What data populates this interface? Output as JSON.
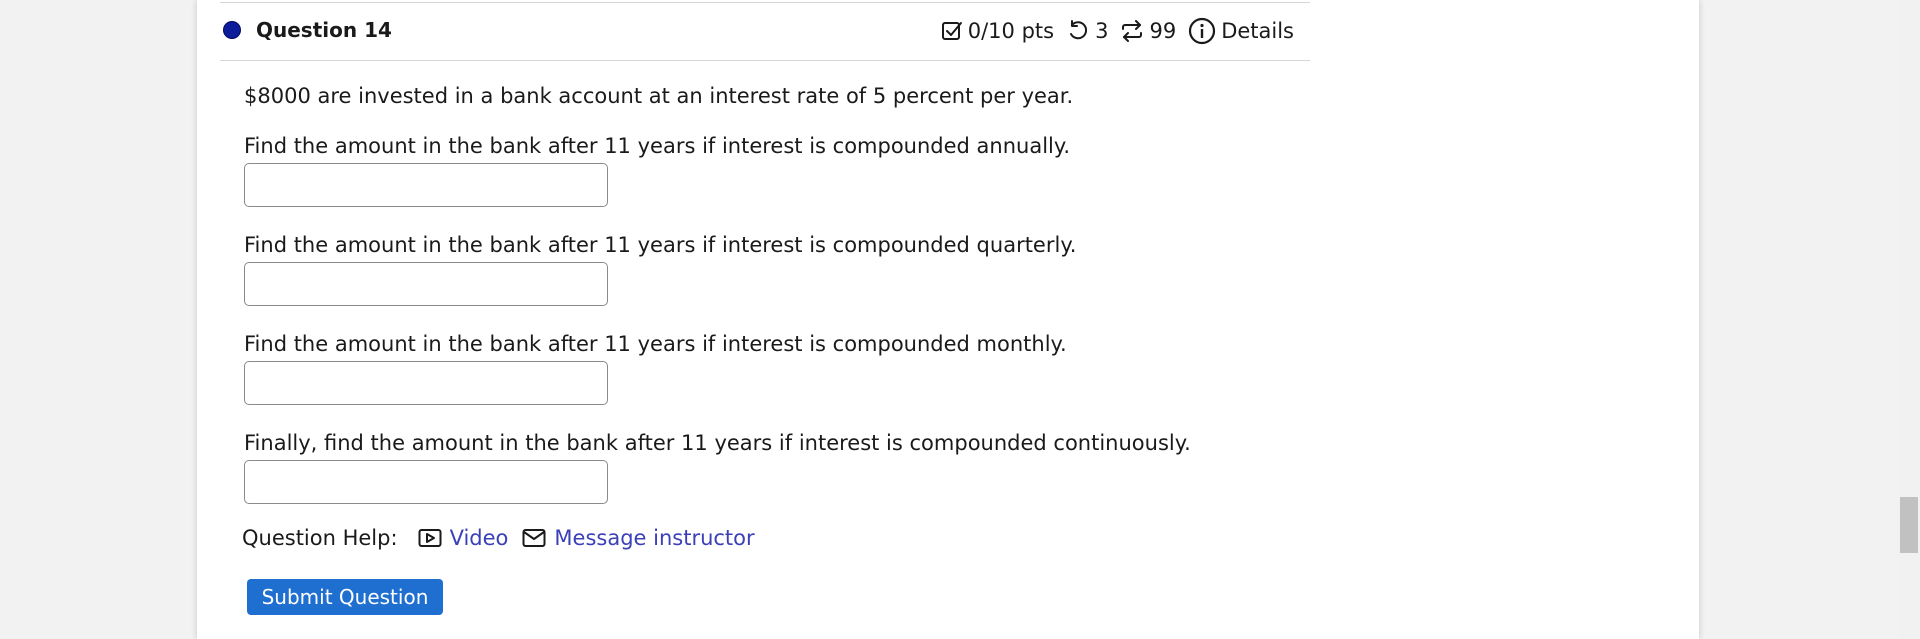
{
  "question": {
    "title": "Question 14",
    "status_color": "#0d1c9a",
    "points": "0/10 pts",
    "retries": "3",
    "attempts": "99",
    "details_label": "Details"
  },
  "body": {
    "intro": "$8000 are invested in a bank account at an interest rate of 5 percent per year.",
    "parts": [
      {
        "prompt": "Find the amount in the bank after 11 years if interest is compounded annually.",
        "value": ""
      },
      {
        "prompt": "Find the amount in the bank after 11 years if interest is compounded quarterly.",
        "value": ""
      },
      {
        "prompt": "Find the amount in the bank after 11 years if interest is compounded monthly.",
        "value": ""
      },
      {
        "prompt": "Finally, find the amount in the bank after 11 years if interest is compounded continuously.",
        "value": ""
      }
    ]
  },
  "help": {
    "label": "Question Help:",
    "video_label": "Video",
    "message_label": "Message instructor",
    "link_color": "#3b3fb8"
  },
  "submit": {
    "label": "Submit Question",
    "color": "#1f6fd1"
  },
  "icons": {
    "points": "checkbox-icon",
    "retries": "undo-icon",
    "attempts": "repeat-icon",
    "details": "info-icon",
    "video": "video-icon",
    "message": "envelope-icon"
  }
}
